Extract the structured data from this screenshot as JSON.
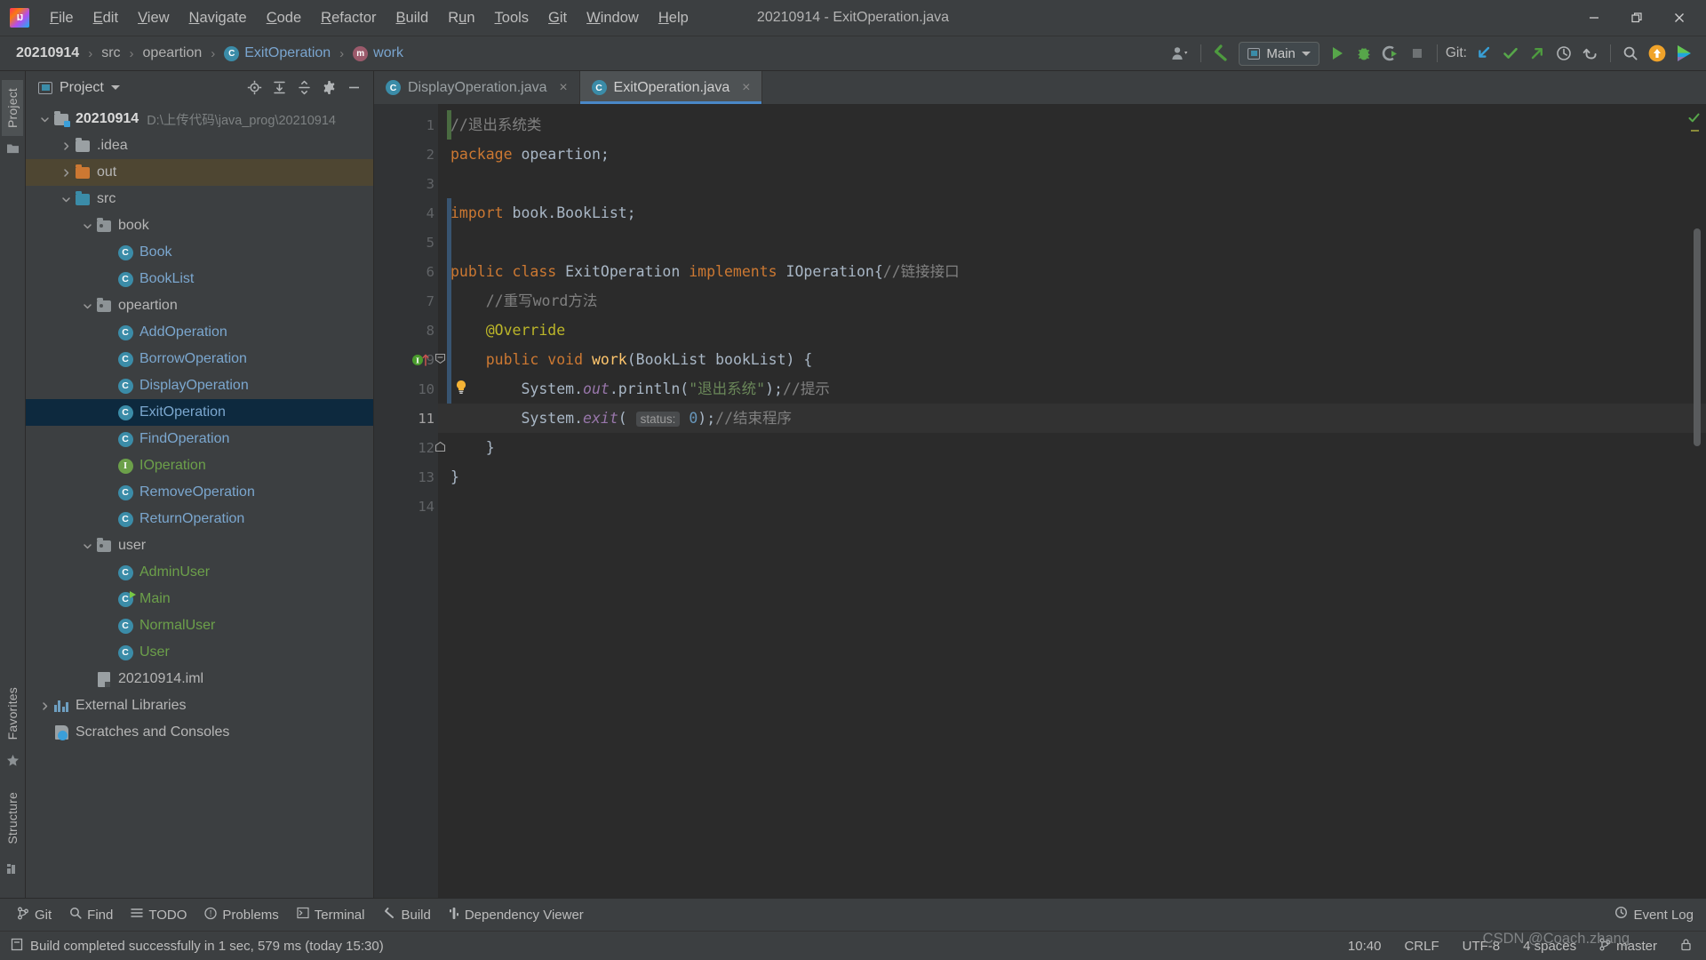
{
  "window": {
    "title": "20210914 - ExitOperation.java",
    "logo_text": "IJ",
    "minimize": "minimize-icon",
    "restore": "restore-icon",
    "close": "close-icon"
  },
  "menubar": {
    "items": [
      {
        "label": "File",
        "mnemonic": "F"
      },
      {
        "label": "Edit",
        "mnemonic": "E"
      },
      {
        "label": "View",
        "mnemonic": "V"
      },
      {
        "label": "Navigate",
        "mnemonic": "N"
      },
      {
        "label": "Code",
        "mnemonic": "C"
      },
      {
        "label": "Refactor",
        "mnemonic": "R"
      },
      {
        "label": "Build",
        "mnemonic": "B"
      },
      {
        "label": "Run",
        "mnemonic": "u"
      },
      {
        "label": "Tools",
        "mnemonic": "T"
      },
      {
        "label": "Git",
        "mnemonic": "G"
      },
      {
        "label": "Window",
        "mnemonic": "W"
      },
      {
        "label": "Help",
        "mnemonic": "H"
      }
    ]
  },
  "navbar": {
    "breadcrumbs": [
      {
        "label": "20210914",
        "kind": "project"
      },
      {
        "label": "src",
        "kind": "folder"
      },
      {
        "label": "opeartion",
        "kind": "folder"
      },
      {
        "label": "ExitOperation",
        "kind": "class",
        "badge": "C"
      },
      {
        "label": "work",
        "kind": "method",
        "badge": "m"
      }
    ],
    "separator": "›",
    "run_config": "Main",
    "git_label": "Git:",
    "toolbar_icons": [
      "user-avatar-icon",
      "back-arrow-icon",
      "run-icon",
      "debug-icon",
      "run-coverage-icon",
      "stop-icon",
      "git-update-icon",
      "git-commit-icon",
      "git-push-icon",
      "git-history-icon",
      "git-rollback-icon",
      "search-everywhere-icon",
      "update-badge-icon",
      "ide-feature-icon"
    ]
  },
  "left_strip": {
    "top_tab": "Project",
    "bottom_tabs": [
      "Structure",
      "Favorites"
    ]
  },
  "project_panel": {
    "title": "Project",
    "header_icons": [
      "locate-icon",
      "expand-all-icon",
      "collapse-all-icon",
      "settings-gear-icon",
      "hide-panel-icon"
    ],
    "tree": [
      {
        "label": "20210914",
        "path": "D:\\上传代码\\java_prog\\20210914",
        "icon": "project-folder-icon",
        "indent": 0,
        "twist": "open",
        "style": "bold"
      },
      {
        "label": ".idea",
        "icon": "folder-icon",
        "indent": 1,
        "twist": "closed",
        "style": "plain"
      },
      {
        "label": "out",
        "icon": "folder-orange-icon",
        "indent": 1,
        "twist": "closed",
        "style": "plain",
        "highlight": true
      },
      {
        "label": "src",
        "icon": "source-folder-icon",
        "indent": 1,
        "twist": "open",
        "style": "plain"
      },
      {
        "label": "book",
        "icon": "package-icon",
        "indent": 2,
        "twist": "open",
        "style": "plain"
      },
      {
        "label": "Book",
        "icon": "class-icon",
        "indent": 3,
        "style": "class"
      },
      {
        "label": "BookList",
        "icon": "class-icon",
        "indent": 3,
        "style": "class"
      },
      {
        "label": "opeartion",
        "icon": "package-icon",
        "indent": 2,
        "twist": "open",
        "style": "plain"
      },
      {
        "label": "AddOperation",
        "icon": "class-icon",
        "indent": 3,
        "style": "class"
      },
      {
        "label": "BorrowOperation",
        "icon": "class-icon",
        "indent": 3,
        "style": "class"
      },
      {
        "label": "DisplayOperation",
        "icon": "class-icon",
        "indent": 3,
        "style": "class"
      },
      {
        "label": "ExitOperation",
        "icon": "class-icon",
        "indent": 3,
        "style": "class",
        "selected": true
      },
      {
        "label": "FindOperation",
        "icon": "class-icon",
        "indent": 3,
        "style": "class"
      },
      {
        "label": "IOperation",
        "icon": "interface-icon",
        "indent": 3,
        "style": "green"
      },
      {
        "label": "RemoveOperation",
        "icon": "class-icon",
        "indent": 3,
        "style": "class"
      },
      {
        "label": "ReturnOperation",
        "icon": "class-icon",
        "indent": 3,
        "style": "class"
      },
      {
        "label": "user",
        "icon": "package-icon",
        "indent": 2,
        "twist": "open",
        "style": "plain"
      },
      {
        "label": "AdminUser",
        "icon": "class-icon",
        "indent": 3,
        "style": "green"
      },
      {
        "label": "Main",
        "icon": "runnable-class-icon",
        "indent": 3,
        "style": "green"
      },
      {
        "label": "NormalUser",
        "icon": "class-icon",
        "indent": 3,
        "style": "green"
      },
      {
        "label": "User",
        "icon": "class-icon",
        "indent": 3,
        "style": "green"
      },
      {
        "label": "20210914.iml",
        "icon": "iml-file-icon",
        "indent": 2,
        "style": "plain"
      },
      {
        "label": "External Libraries",
        "icon": "libraries-icon",
        "indent": 0,
        "twist": "closed",
        "style": "plain"
      },
      {
        "label": "Scratches and Consoles",
        "icon": "scratches-icon",
        "indent": 0,
        "style": "plain"
      }
    ]
  },
  "editor": {
    "tabs": [
      {
        "label": "DisplayOperation.java",
        "icon": "class-icon",
        "active": false,
        "close": "×"
      },
      {
        "label": "ExitOperation.java",
        "icon": "class-icon",
        "active": true,
        "close": "×"
      }
    ],
    "line_numbers": [
      "1",
      "2",
      "3",
      "4",
      "5",
      "6",
      "7",
      "8",
      "9",
      "10",
      "11",
      "12",
      "13",
      "14"
    ],
    "current_line": 11,
    "gutter_icons": [
      {
        "line": 9,
        "icon": "implementing-method-icon"
      },
      {
        "line": 9,
        "icon": "fold-minus-icon"
      },
      {
        "line": 10,
        "icon": "intention-bulb-icon"
      },
      {
        "line": 12,
        "icon": "fold-end-icon"
      }
    ],
    "code_lines": [
      {
        "n": 1,
        "tokens": [
          {
            "t": "//退出系统类",
            "c": "cm"
          }
        ]
      },
      {
        "n": 2,
        "tokens": [
          {
            "t": "package",
            "c": "k"
          },
          {
            "t": " opeartion;",
            "c": "id"
          }
        ]
      },
      {
        "n": 3,
        "tokens": []
      },
      {
        "n": 4,
        "tokens": [
          {
            "t": "import",
            "c": "k"
          },
          {
            "t": " book.BookList;",
            "c": "id"
          }
        ]
      },
      {
        "n": 5,
        "tokens": []
      },
      {
        "n": 6,
        "tokens": [
          {
            "t": "public",
            "c": "k"
          },
          {
            "t": " ",
            "c": "id"
          },
          {
            "t": "class",
            "c": "k"
          },
          {
            "t": " ExitOperation ",
            "c": "id"
          },
          {
            "t": "implements",
            "c": "k"
          },
          {
            "t": " IOperation{",
            "c": "id"
          },
          {
            "t": "//链接接口",
            "c": "cm"
          }
        ]
      },
      {
        "n": 7,
        "tokens": [
          {
            "t": "    //重写word方法",
            "c": "cm"
          }
        ]
      },
      {
        "n": 8,
        "tokens": [
          {
            "t": "    @Override",
            "c": "an"
          }
        ]
      },
      {
        "n": 9,
        "tokens": [
          {
            "t": "    ",
            "c": "id"
          },
          {
            "t": "public",
            "c": "k"
          },
          {
            "t": " ",
            "c": "id"
          },
          {
            "t": "void",
            "c": "k"
          },
          {
            "t": " ",
            "c": "id"
          },
          {
            "t": "work",
            "c": "fn"
          },
          {
            "t": "(BookList bookList) {",
            "c": "id"
          }
        ]
      },
      {
        "n": 10,
        "tokens": [
          {
            "t": "        System.",
            "c": "id"
          },
          {
            "t": "out",
            "c": "st"
          },
          {
            "t": ".println(",
            "c": "id"
          },
          {
            "t": "\"退出系统\"",
            "c": "s"
          },
          {
            "t": ");",
            "c": "id"
          },
          {
            "t": "//提示",
            "c": "cm"
          }
        ]
      },
      {
        "n": 11,
        "tokens": [
          {
            "t": "        System.",
            "c": "id"
          },
          {
            "t": "exit",
            "c": "st"
          },
          {
            "t": "( ",
            "c": "id"
          },
          {
            "t": "status:",
            "c": "hint"
          },
          {
            "t": " ",
            "c": "id"
          },
          {
            "t": "0",
            "c": "nm"
          },
          {
            "t": ");",
            "c": "id"
          },
          {
            "t": "//结束程序",
            "c": "cm"
          }
        ]
      },
      {
        "n": 12,
        "tokens": [
          {
            "t": "    }",
            "c": "id"
          }
        ]
      },
      {
        "n": 13,
        "tokens": [
          {
            "t": "}",
            "c": "id"
          }
        ]
      },
      {
        "n": 14,
        "tokens": []
      }
    ],
    "inspection_status": "ok-check-icon"
  },
  "toolwindows": {
    "items": [
      {
        "label": "Git",
        "icon": "git-branch-icon"
      },
      {
        "label": "Find",
        "icon": "search-icon"
      },
      {
        "label": "TODO",
        "icon": "todo-list-icon"
      },
      {
        "label": "Problems",
        "icon": "problems-icon"
      },
      {
        "label": "Terminal",
        "icon": "terminal-icon"
      },
      {
        "label": "Build",
        "icon": "build-hammer-icon"
      },
      {
        "label": "Dependency Viewer",
        "icon": "dependency-icon"
      }
    ],
    "event_log": "Event Log",
    "event_log_icon": "event-log-icon"
  },
  "statusbar": {
    "message": "Build completed successfully in 1 sec, 579 ms (today 15:30)",
    "message_icon": "build-status-icon",
    "position": "10:40",
    "line_separator": "CRLF",
    "encoding": "UTF-8",
    "indent": "4 spaces",
    "branch": "master",
    "branch_icon": "git-branch-icon",
    "lock_icon": "read-only-icon"
  },
  "watermark": "CSDN @Coach.zhang",
  "colors": {
    "accent_blue": "#4a88c7",
    "class_blue": "#7ba7cf",
    "green": "#6ca04a",
    "keyword_orange": "#cc7832",
    "string_green": "#6a8759",
    "annotation_yellow": "#bbb529",
    "selection": "#0d293e",
    "panel_bg": "#3c3f41",
    "editor_bg": "#2b2b2b"
  }
}
